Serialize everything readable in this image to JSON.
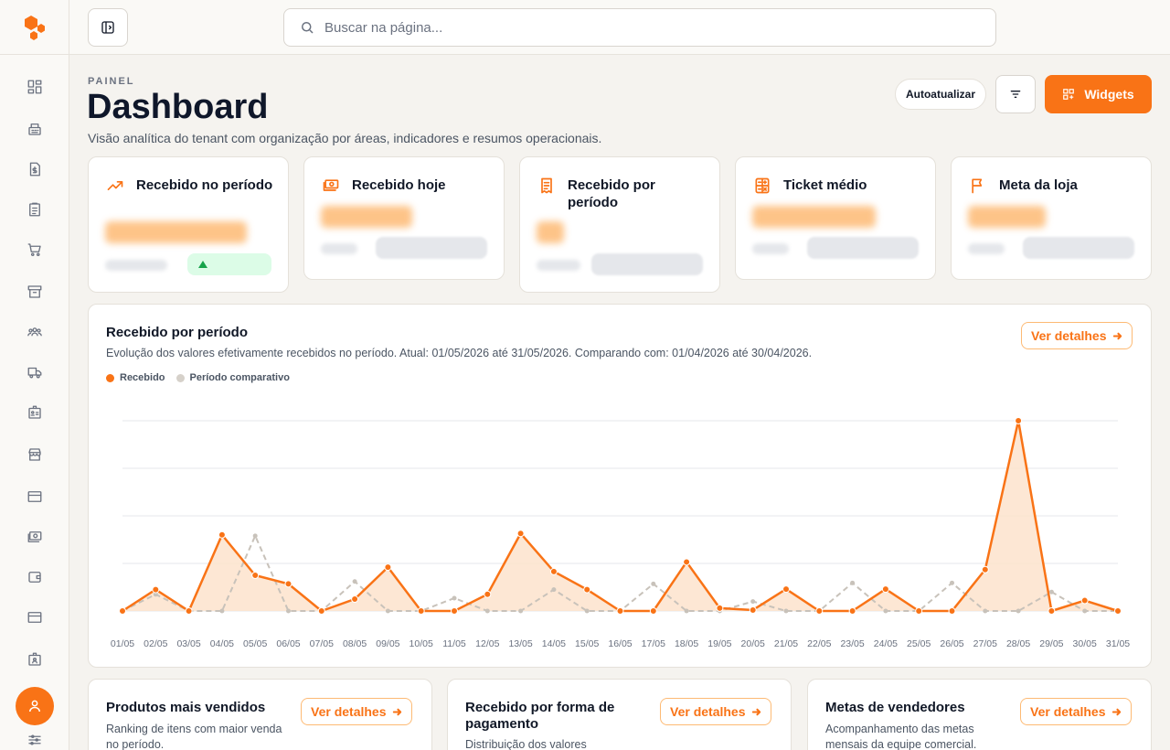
{
  "search": {
    "placeholder": "Buscar na página..."
  },
  "header": {
    "eyebrow": "PAINEL",
    "title": "Dashboard",
    "subtitle": "Visão analítica do tenant com organização por áreas, indicadores e resumos operacionais.",
    "autoupdate_label": "Autoatualizar",
    "widgets_label": "Widgets"
  },
  "kpis": [
    {
      "label": "Recebido no período",
      "icon": "trending-up-icon"
    },
    {
      "label": "Recebido hoje",
      "icon": "cash-icon"
    },
    {
      "label": "Recebido por período",
      "icon": "receipt-icon"
    },
    {
      "label": "Ticket médio",
      "icon": "calculator-icon"
    },
    {
      "label": "Meta da loja",
      "icon": "flag-icon"
    }
  ],
  "chart_card": {
    "title": "Recebido por período",
    "description": "Evolução dos valores efetivamente recebidos no período. Atual: 01/05/2026 até 31/05/2026. Comparando com: 01/04/2026 até 30/04/2026.",
    "details_label": "Ver detalhes"
  },
  "chart_data": {
    "type": "line",
    "x": [
      "01/05",
      "02/05",
      "03/05",
      "04/05",
      "05/05",
      "06/05",
      "07/05",
      "08/05",
      "09/05",
      "10/05",
      "11/05",
      "12/05",
      "13/05",
      "14/05",
      "15/05",
      "16/05",
      "17/05",
      "18/05",
      "19/05",
      "20/05",
      "21/05",
      "22/05",
      "23/05",
      "24/05",
      "25/05",
      "26/05",
      "27/05",
      "28/05",
      "29/05",
      "30/05",
      "31/05"
    ],
    "series": [
      {
        "name": "Recebido",
        "color": "#f97316",
        "style": "solid-area",
        "values": [
          0,
          0.45,
          0,
          1.6,
          0.75,
          0.57,
          0,
          0.25,
          0.92,
          0,
          0,
          0.35,
          1.63,
          0.83,
          0.45,
          0,
          0,
          1.03,
          0.06,
          0.02,
          0.46,
          0,
          0,
          0.46,
          0,
          0,
          0.87,
          4.0,
          0,
          0.22,
          0
        ]
      },
      {
        "name": "Período comparativo",
        "color": "#c8c2ba",
        "style": "dashed",
        "values": [
          0,
          0.35,
          0,
          0,
          1.58,
          0,
          0,
          0.62,
          0,
          0,
          0.27,
          0,
          0,
          0.45,
          0,
          0,
          0.57,
          0,
          0,
          0.2,
          0,
          0,
          0.59,
          0,
          0,
          0.59,
          0,
          0,
          0.4,
          0,
          0
        ]
      }
    ],
    "ylim": [
      0,
      4
    ],
    "grid": true,
    "legend": "top-left"
  },
  "bottom_cards": [
    {
      "title": "Produtos mais vendidos",
      "description": "Ranking de itens com maior venda no período.",
      "details_label": "Ver detalhes"
    },
    {
      "title": "Recebido por forma de pagamento",
      "description": "Distribuição dos valores",
      "details_label": "Ver detalhes"
    },
    {
      "title": "Metas de vendedores",
      "description": "Acompanhamento das metas mensais da equipe comercial.",
      "details_label": "Ver detalhes"
    }
  ],
  "colors": {
    "accent": "#f97316",
    "background": "#f5f3ef",
    "comparison": "#c8c2ba"
  }
}
